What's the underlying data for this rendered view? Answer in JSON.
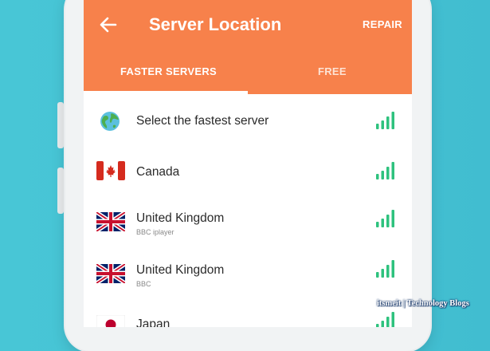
{
  "header": {
    "title": "Server Location",
    "repair_label": "REPAIR"
  },
  "tabs": [
    {
      "label": "FASTER SERVERS",
      "active": true
    },
    {
      "label": "FREE",
      "active": false
    }
  ],
  "servers": [
    {
      "name": "Select the fastest server",
      "subtitle": "",
      "icon": "globe-icon"
    },
    {
      "name": "Canada",
      "subtitle": "",
      "icon": "canada-flag-icon"
    },
    {
      "name": "United Kingdom",
      "subtitle": "BBC iplayer",
      "icon": "uk-flag-icon"
    },
    {
      "name": "United Kingdom",
      "subtitle": "BBC",
      "icon": "uk-flag-icon"
    },
    {
      "name": "Japan",
      "subtitle": "",
      "icon": "japan-flag-icon"
    }
  ],
  "watermark": "itsmeit | Technology Blogs",
  "colors": {
    "appbar": "#f7814b",
    "background": "#45c3d4",
    "signal": "#2ec27e"
  }
}
